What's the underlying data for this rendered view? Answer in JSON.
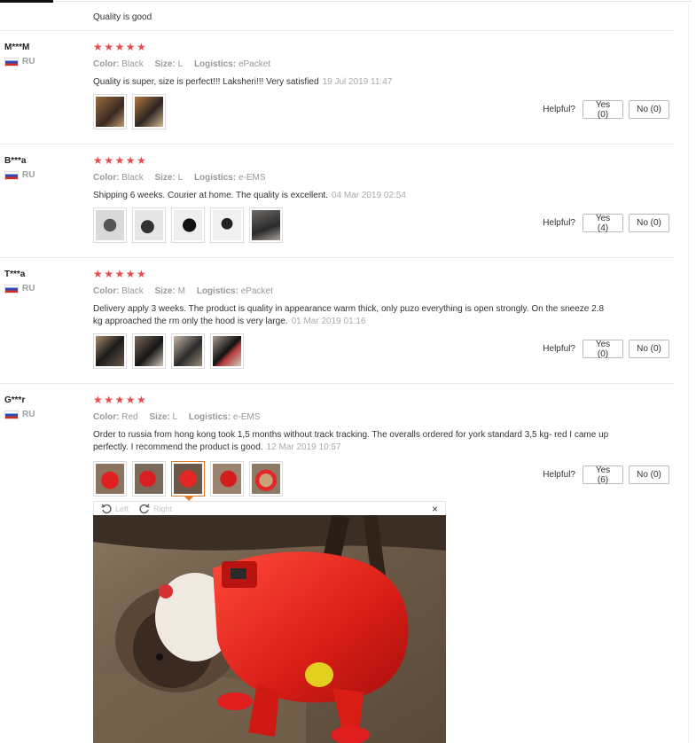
{
  "top": {
    "text": "Quality is good"
  },
  "reviews": [
    {
      "user": "M***M",
      "country": "RU",
      "rating": "★★★★★",
      "color_label": "Color:",
      "color": "Black",
      "size_label": "Size:",
      "size": "L",
      "logistics_label": "Logistics:",
      "logistics": "ePacket",
      "text": "Quality is super, size is perfect!!! Laksheri!!! Very satisfied",
      "date": "19 Jul 2019 11:47",
      "helpful_label": "Helpful?",
      "yes": "Yes (0)",
      "no": "No (0)",
      "images": [
        "brown-dog-photo",
        "brown-dog-photo"
      ]
    },
    {
      "user": "B***a",
      "country": "RU",
      "rating": "★★★★★",
      "color_label": "Color:",
      "color": "Black",
      "size_label": "Size:",
      "size": "L",
      "logistics_label": "Logistics:",
      "logistics": "e-EMS",
      "text": "Shipping 6 weeks. Courier at home. The quality is excellent.",
      "date": "04 Mar 2019 02:54",
      "helpful_label": "Helpful?",
      "yes": "Yes (4)",
      "no": "No (0)",
      "images": [
        "black-suit-photo",
        "black-suit-photo",
        "black-suit-photo",
        "black-suit-photo",
        "cat-photo"
      ]
    },
    {
      "user": "T***a",
      "country": "RU",
      "rating": "★★★★★",
      "color_label": "Color:",
      "color": "Black",
      "size_label": "Size:",
      "size": "M",
      "logistics_label": "Logistics:",
      "logistics": "ePacket",
      "text": "Delivery apply 3 weeks. The product is quality in appearance warm thick, only puzo everything is open strongly. On the sneeze 2.8 kg approached the rm only the hood is very large.",
      "date": "01 Mar 2019 01:16",
      "helpful_label": "Helpful?",
      "yes": "Yes (0)",
      "no": "No (0)",
      "images": [
        "dog-black-suit-photo",
        "dog-black-suit-photo",
        "dog-black-suit-photo",
        "dog-black-suit-photo"
      ]
    },
    {
      "user": "G***r",
      "country": "RU",
      "rating": "★★★★★",
      "color_label": "Color:",
      "color": "Red",
      "size_label": "Size:",
      "size": "L",
      "logistics_label": "Logistics:",
      "logistics": "e-EMS",
      "text": "Order to russia from hong kong took 1,5 months without track tracking. The overalls ordered for york standard 3,5 kg- red I came up perfectly. I recommend the product is good.",
      "date": "12 Mar 2019 10:57",
      "helpful_label": "Helpful?",
      "yes": "Yes (6)",
      "no": "No (0)",
      "images": [
        "dog-red-suit-photo",
        "dog-red-suit-photo",
        "dog-red-suit-photo",
        "dog-red-suit-photo",
        "dog-red-suit-photo"
      ],
      "active_image": 2
    }
  ],
  "viewer": {
    "left_label": "Left",
    "right_label": "Right",
    "close": "×"
  },
  "colors": {
    "star": "#e84b4b",
    "active_thumb": "#e17b2a",
    "muted": "#999999"
  }
}
